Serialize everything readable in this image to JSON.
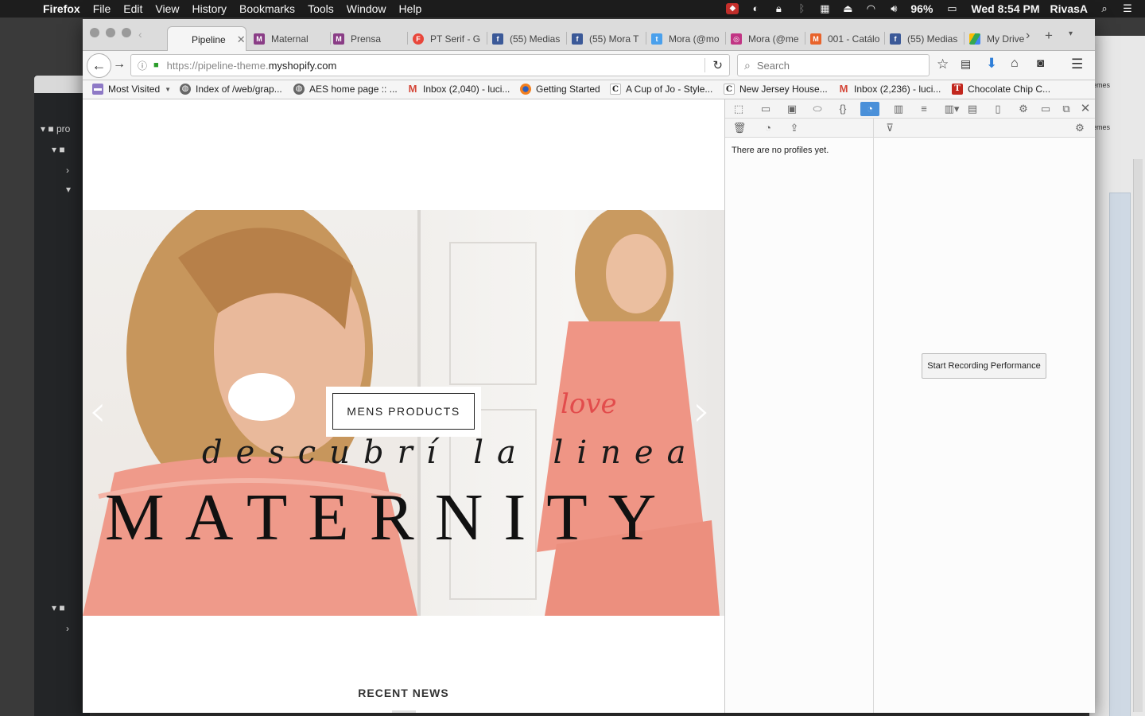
{
  "menubar": {
    "app": "Firefox",
    "menus": [
      "File",
      "Edit",
      "View",
      "History",
      "Bookmarks",
      "Tools",
      "Window",
      "Help"
    ],
    "battery": "96%",
    "clock": "Wed 8:54 PM",
    "user": "RivasA"
  },
  "tabs": [
    {
      "label": "Pipeline",
      "icon": "none",
      "active": true
    },
    {
      "label": "Maternal",
      "icon": "maternal-favicon"
    },
    {
      "label": "Prensa",
      "icon": "maternal-favicon"
    },
    {
      "label": "PT Serif - G",
      "icon": "fontfont-favicon"
    },
    {
      "label": "(55) Medias",
      "icon": "facebook-favicon"
    },
    {
      "label": "(55) Mora T",
      "icon": "facebook-favicon"
    },
    {
      "label": "Mora (@mo",
      "icon": "twitter-favicon"
    },
    {
      "label": "Mora (@me",
      "icon": "instagram-favicon"
    },
    {
      "label": "001 - Catálo",
      "icon": "magento-favicon"
    },
    {
      "label": "(55) Medias",
      "icon": "facebook-favicon"
    },
    {
      "label": "My Drive",
      "icon": "drive-favicon"
    }
  ],
  "url": {
    "prefix": "https://pipeline-theme.",
    "host": "myshopify.com"
  },
  "search": {
    "placeholder": "Search"
  },
  "bookmarks": [
    {
      "label": "Most Visited",
      "icon": "folder-icon",
      "dropdown": true
    },
    {
      "label": "Index of /web/grap...",
      "icon": "globe-icon"
    },
    {
      "label": "AES home page :: ...",
      "icon": "globe-icon"
    },
    {
      "label": "Inbox (2,040) - luci...",
      "icon": "gmail-icon"
    },
    {
      "label": "Getting Started",
      "icon": "firefox-icon"
    },
    {
      "label": "A Cup of Jo - Style...",
      "icon": "c-icon"
    },
    {
      "label": "New Jersey House...",
      "icon": "c-icon"
    },
    {
      "label": "Inbox (2,236) - luci...",
      "icon": "gmail-icon"
    },
    {
      "label": "Chocolate Chip C...",
      "icon": "nyt-icon"
    }
  ],
  "hero": {
    "button": "MENS PRODUCTS",
    "script_line": "descubrí la linea",
    "headline": "MATERNITY"
  },
  "sections": {
    "recent_news": "RECENT NEWS"
  },
  "devtools": {
    "empty_profiles": "There are no profiles yet.",
    "record_button": "Start Recording Performance"
  },
  "editor_sidebar": {
    "row1": "pro"
  },
  "side_window": {
    "label1": "emes",
    "label2": "emes"
  },
  "colors": {
    "accent": "#4a90d9",
    "page_bg": "#ffffff",
    "devtools_bg": "#fcfcfc"
  }
}
